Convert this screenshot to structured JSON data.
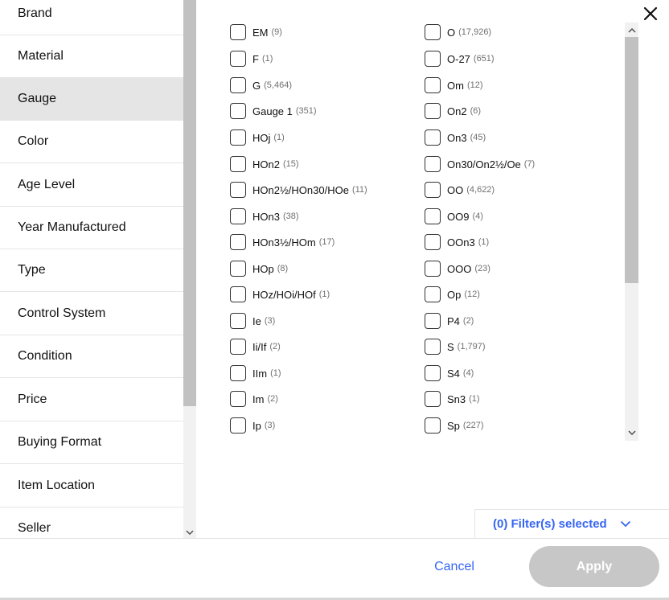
{
  "sidebar": {
    "items": [
      {
        "label": "Brand"
      },
      {
        "label": "Material"
      },
      {
        "label": "Gauge",
        "selected": true
      },
      {
        "label": "Color"
      },
      {
        "label": "Age Level"
      },
      {
        "label": "Year Manufactured"
      },
      {
        "label": "Type"
      },
      {
        "label": "Control System"
      },
      {
        "label": "Condition"
      },
      {
        "label": "Price"
      },
      {
        "label": "Buying Format"
      },
      {
        "label": "Item Location"
      },
      {
        "label": "Seller"
      }
    ]
  },
  "options": {
    "left_column": [
      {
        "label": "EM",
        "count": "(9)"
      },
      {
        "label": "F",
        "count": "(1)"
      },
      {
        "label": "G",
        "count": "(5,464)"
      },
      {
        "label": "Gauge 1",
        "count": "(351)"
      },
      {
        "label": "HOj",
        "count": "(1)"
      },
      {
        "label": "HOn2",
        "count": "(15)"
      },
      {
        "label": "HOn2½/HOn30/HOe",
        "count": "(11)"
      },
      {
        "label": "HOn3",
        "count": "(38)"
      },
      {
        "label": "HOn3½/HOm",
        "count": "(17)"
      },
      {
        "label": "HOp",
        "count": "(8)"
      },
      {
        "label": "HOz/HOi/HOf",
        "count": "(1)"
      },
      {
        "label": "Ie",
        "count": "(3)"
      },
      {
        "label": "Ii/If",
        "count": "(2)"
      },
      {
        "label": "IIm",
        "count": "(1)"
      },
      {
        "label": "Im",
        "count": "(2)"
      },
      {
        "label": "Ip",
        "count": "(3)"
      }
    ],
    "right_column": [
      {
        "label": "O",
        "count": "(17,926)"
      },
      {
        "label": "O-27",
        "count": "(651)"
      },
      {
        "label": "Om",
        "count": "(12)"
      },
      {
        "label": "On2",
        "count": "(6)"
      },
      {
        "label": "On3",
        "count": "(45)"
      },
      {
        "label": "On30/On2½/Oe",
        "count": "(7)"
      },
      {
        "label": "OO",
        "count": "(4,622)"
      },
      {
        "label": "OO9",
        "count": "(4)"
      },
      {
        "label": "OOn3",
        "count": "(1)"
      },
      {
        "label": "OOO",
        "count": "(23)"
      },
      {
        "label": "Op",
        "count": "(12)"
      },
      {
        "label": "P4",
        "count": "(2)"
      },
      {
        "label": "S",
        "count": "(1,797)"
      },
      {
        "label": "S4",
        "count": "(4)"
      },
      {
        "label": "Sn3",
        "count": "(1)"
      },
      {
        "label": "Sp",
        "count": "(227)"
      }
    ]
  },
  "filters_selected": {
    "label": "(0) Filter(s) selected"
  },
  "footer": {
    "cancel_label": "Cancel",
    "apply_label": "Apply"
  },
  "icons": {
    "close": "close-icon",
    "chevron_down": "chevron-down-icon",
    "scroll_up": "scroll-up-arrow-icon",
    "scroll_down": "scroll-down-arrow-icon"
  },
  "colors": {
    "accent": "#3665f3",
    "selected_bg": "#e5e5e5",
    "apply_disabled": "#c7c7c7",
    "count_text": "#707070"
  }
}
